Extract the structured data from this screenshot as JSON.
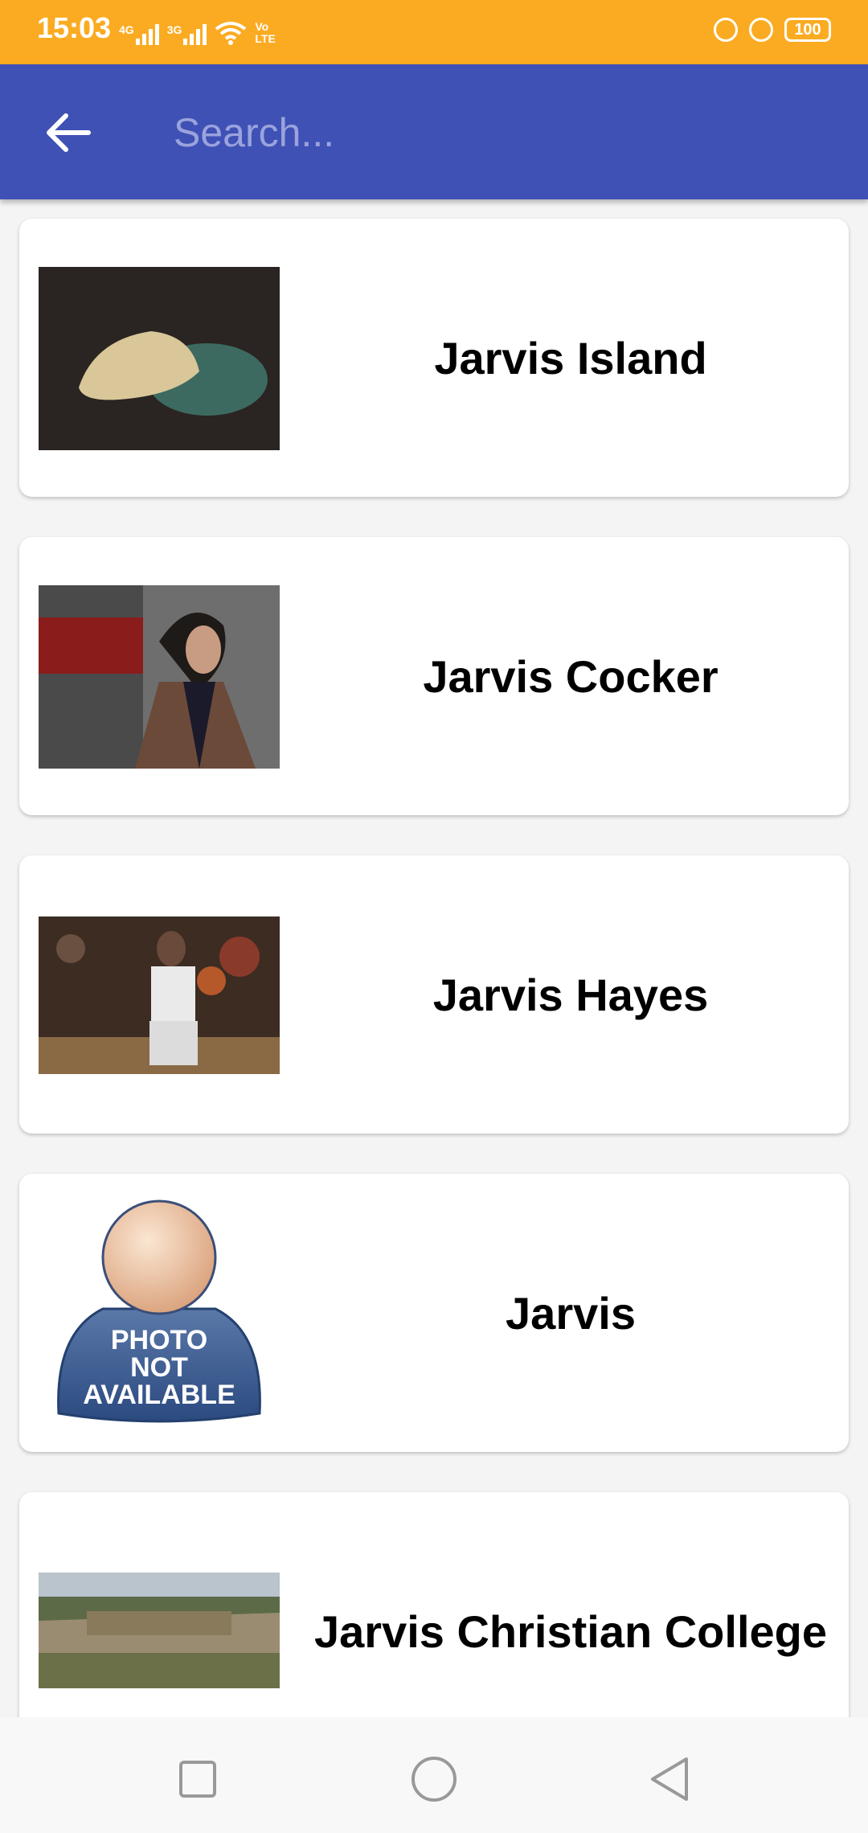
{
  "status_bar": {
    "time": "15:03",
    "signal_1_label": "4G",
    "signal_2_label": "3G",
    "volte_label": "Vo LTE",
    "battery": "100"
  },
  "app_bar": {
    "search_placeholder": "Search...",
    "search_value": ""
  },
  "results": [
    {
      "title": "Jarvis Island",
      "image": "island-aerial-photo"
    },
    {
      "title": "Jarvis Cocker",
      "image": "person-portrait-photo"
    },
    {
      "title": "Jarvis Hayes",
      "image": "basketball-player-photo"
    },
    {
      "title": "Jarvis",
      "image": "photo-not-available-placeholder",
      "placeholder_text": [
        "PHOTO",
        "NOT",
        "AVAILABLE"
      ]
    },
    {
      "title": "Jarvis Christian College",
      "image": "college-sign-photo"
    }
  ],
  "colors": {
    "status_bar": "#fbab22",
    "app_bar": "#3f51b5",
    "background": "#f4f4f4"
  },
  "nav_bar": {
    "icons": [
      "recent-apps-icon",
      "home-icon",
      "back-icon"
    ]
  }
}
